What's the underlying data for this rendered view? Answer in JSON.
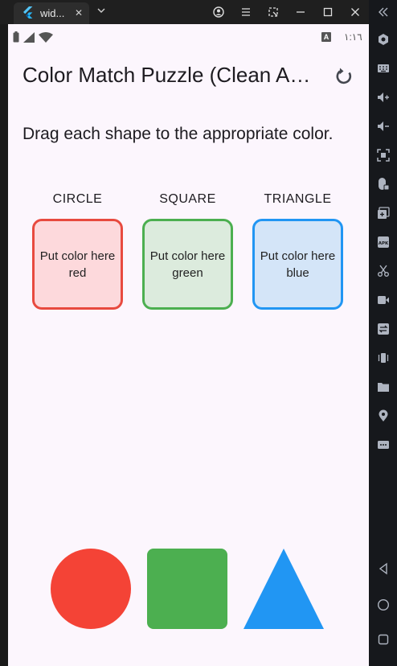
{
  "window": {
    "tab_title": "wid...",
    "tab_close": "✕"
  },
  "status_bar": {
    "time": "١:١٦",
    "keyboard_badge": "A"
  },
  "app_bar": {
    "title": "Color Match Puzzle (Clean Architecture)"
  },
  "instructions": "Drag each shape to the appropriate color.",
  "targets": [
    {
      "label": "CIRCLE",
      "line1": "Put color here",
      "line2": "red",
      "border": "#e84a3f",
      "fill": "#fdd9dc"
    },
    {
      "label": "SQUARE",
      "line1": "Put color here",
      "line2": "green",
      "border": "#4caf50",
      "fill": "#dcebdd"
    },
    {
      "label": "TRIANGLE",
      "line1": "Put color here",
      "line2": "blue",
      "border": "#2196f3",
      "fill": "#d4e5f8"
    }
  ],
  "shapes": [
    {
      "name": "circle",
      "color": "#f44336"
    },
    {
      "name": "square",
      "color": "#4caf50"
    },
    {
      "name": "triangle",
      "color": "#2196f3"
    }
  ]
}
